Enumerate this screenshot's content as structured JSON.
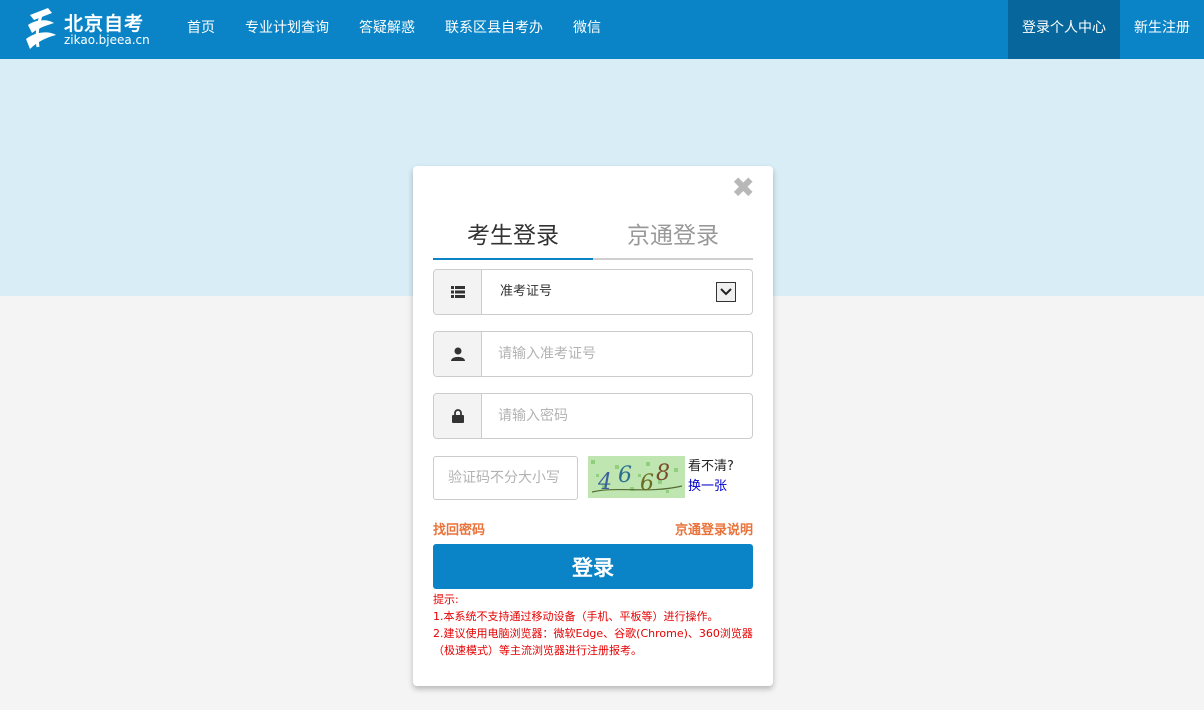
{
  "header": {
    "logo_title": "北京自考",
    "logo_subtitle": "zikao.bjeea.cn",
    "nav": [
      "首页",
      "专业计划查询",
      "答疑解惑",
      "联系区县自考办",
      "微信"
    ],
    "nav_right": [
      "登录个人中心",
      "新生注册"
    ]
  },
  "login": {
    "tabs": [
      "考生登录",
      "京通登录"
    ],
    "id_type_selected": "准考证号",
    "id_placeholder": "请输入准考证号",
    "password_placeholder": "请输入密码",
    "captcha_placeholder": "验证码不分大小写",
    "captcha_hint": "看不清?",
    "captcha_refresh": "换一张",
    "forgot_password": "找回密码",
    "jingtong_help": "京通登录说明",
    "submit_label": "登录",
    "tips": [
      "提示:",
      "1.本系统不支持通过移动设备（手机、平板等）进行操作。",
      "2.建议使用电脑浏览器：微软Edge、谷歌(Chrome)、360浏览器（极速模式）等主流浏览器进行注册报考。"
    ]
  },
  "colors": {
    "primary": "#0a84c6",
    "primary_dark": "#07679d",
    "band": "#d9edf7",
    "link_orange": "#e9733a",
    "tip_red": "#e60000"
  }
}
